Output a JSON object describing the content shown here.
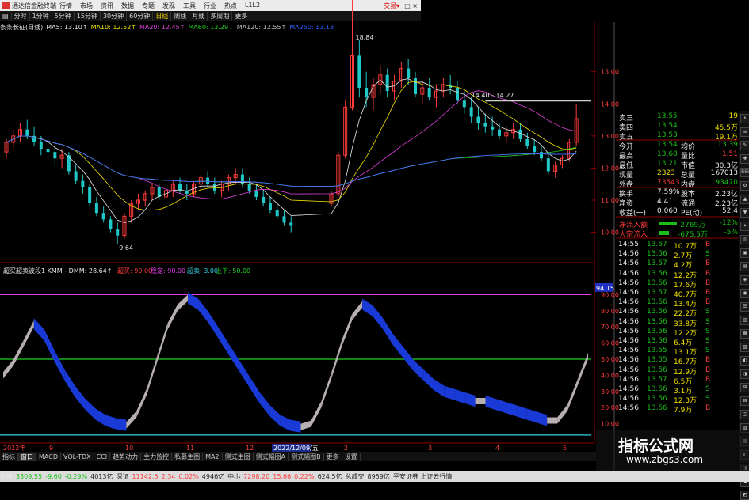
{
  "window": {
    "title": "通达信金融终端",
    "menu": [
      "行情",
      "市场",
      "资讯",
      "数据",
      "专题",
      "发现",
      "工具",
      "行业",
      "热点",
      "L1L2"
    ],
    "trade": "交易▾",
    "controls": "□ ×"
  },
  "period_tabs": [
    {
      "label": "分时"
    },
    {
      "label": "1分钟"
    },
    {
      "label": "5分钟"
    },
    {
      "label": "15分钟"
    },
    {
      "label": "30分钟"
    },
    {
      "label": "60分钟"
    },
    {
      "label": "日线",
      "active": true
    },
    {
      "label": "周线"
    },
    {
      "label": "月线"
    },
    {
      "label": "多周期"
    },
    {
      "label": "更多"
    }
  ],
  "ma_legend": {
    "name": "条条长征(日线)",
    "items": [
      {
        "text": "MA5: 13.10↑",
        "color": "#e8e8e8"
      },
      {
        "text": "MA10: 12.52↑",
        "color": "#f0e000"
      },
      {
        "text": "MA20: 12.45↑",
        "color": "#e040e0"
      },
      {
        "text": "MA60: 13.29↓",
        "color": "#20d020"
      },
      {
        "text": "MA120: 12.55↑",
        "color": "#c0c0c0"
      },
      {
        "text": "MA250: 13.13",
        "color": "#3060ff"
      }
    ]
  },
  "price_axis": {
    "labels": [
      "15.00",
      "14.00",
      "13.00",
      "12.00",
      "11.00",
      "10.00"
    ],
    "values": [
      15,
      14,
      13,
      12,
      11,
      10
    ]
  },
  "annotations": {
    "high": "18.84",
    "low": "9.64",
    "range": "14.40 - 14.27"
  },
  "indicator_legend": {
    "name": "超买超卖波段1 KMM - DMM: 28.64↑",
    "over_buy": "超买: 90.00",
    "calm": "稳定: 90.00",
    "over_sell": "超卖: 3.00",
    "up_down": "上下: 50.00"
  },
  "indicator_axis": {
    "labels": [
      "90.00",
      "80.00",
      "70.00",
      "60.00",
      "50.00",
      "40.00",
      "30.00",
      "20.00",
      "10.00"
    ],
    "values": [
      90,
      80,
      70,
      60,
      50,
      40,
      30,
      20,
      10
    ],
    "current": "94.15"
  },
  "time_axis": {
    "labels": [
      "2022年",
      "9",
      "10",
      "11",
      "12",
      "2022/12/09/五",
      "2",
      "3",
      "4",
      "5"
    ]
  },
  "chart_data": [
    {
      "type": "candlestick",
      "title": "条条长征(日线)",
      "ylim": [
        9.3,
        16.2
      ],
      "ohlc": [
        [
          12.5,
          12.9,
          12.3,
          12.8
        ],
        [
          12.8,
          13.2,
          12.6,
          13.0
        ],
        [
          13.0,
          13.4,
          12.8,
          13.2
        ],
        [
          13.2,
          13.5,
          12.9,
          13.0
        ],
        [
          13.0,
          13.3,
          12.7,
          12.8
        ],
        [
          12.8,
          13.0,
          12.4,
          12.6
        ],
        [
          12.6,
          12.9,
          12.3,
          12.5
        ],
        [
          12.5,
          12.7,
          12.1,
          12.3
        ],
        [
          12.3,
          12.6,
          12.0,
          12.4
        ],
        [
          12.4,
          12.5,
          11.8,
          11.9
        ],
        [
          11.9,
          12.1,
          11.5,
          11.6
        ],
        [
          11.6,
          11.8,
          11.2,
          11.4
        ],
        [
          11.4,
          11.5,
          10.8,
          10.9
        ],
        [
          10.9,
          11.1,
          10.5,
          10.6
        ],
        [
          10.6,
          10.8,
          10.3,
          10.4
        ],
        [
          10.4,
          10.5,
          10.0,
          10.1
        ],
        [
          10.1,
          10.3,
          9.64,
          9.9
        ],
        [
          9.9,
          10.6,
          9.8,
          10.5
        ],
        [
          10.5,
          11.0,
          10.3,
          10.9
        ],
        [
          10.9,
          11.2,
          10.7,
          11.0
        ],
        [
          11.0,
          11.3,
          10.8,
          11.2
        ],
        [
          11.2,
          11.5,
          11.0,
          11.4
        ],
        [
          11.4,
          11.5,
          11.0,
          11.1
        ],
        [
          11.1,
          11.4,
          10.9,
          11.3
        ],
        [
          11.3,
          11.6,
          11.1,
          11.5
        ],
        [
          11.5,
          11.7,
          11.2,
          11.3
        ],
        [
          11.3,
          11.5,
          11.0,
          11.2
        ],
        [
          11.2,
          11.6,
          11.1,
          11.5
        ],
        [
          11.5,
          11.8,
          11.3,
          11.7
        ],
        [
          11.7,
          11.9,
          11.4,
          11.5
        ],
        [
          11.5,
          11.7,
          11.2,
          11.3
        ],
        [
          11.3,
          11.6,
          11.1,
          11.5
        ],
        [
          11.5,
          11.8,
          11.3,
          11.7
        ],
        [
          11.7,
          12.0,
          11.5,
          11.8
        ],
        [
          11.8,
          12.0,
          11.4,
          11.5
        ],
        [
          11.5,
          11.7,
          11.2,
          11.3
        ],
        [
          11.3,
          11.5,
          11.0,
          11.1
        ],
        [
          11.1,
          11.3,
          10.8,
          10.9
        ],
        [
          10.9,
          11.1,
          10.6,
          10.7
        ],
        [
          10.7,
          10.9,
          10.4,
          10.5
        ],
        [
          10.5,
          10.7,
          10.2,
          10.3
        ],
        [
          10.3,
          10.5,
          10.0,
          10.2
        ],
        [
          10.9,
          11.3,
          10.8,
          11.2
        ],
        [
          11.2,
          12.5,
          11.1,
          12.4
        ],
        [
          12.4,
          14.1,
          12.3,
          13.9
        ],
        [
          13.9,
          18.84,
          13.8,
          15.5
        ],
        [
          15.5,
          16.0,
          14.2,
          14.5
        ],
        [
          14.5,
          15.0,
          13.9,
          14.2
        ],
        [
          14.2,
          14.8,
          13.8,
          14.6
        ],
        [
          14.6,
          15.2,
          14.3,
          14.9
        ],
        [
          14.9,
          15.1,
          14.2,
          14.4
        ],
        [
          14.4,
          14.9,
          14.1,
          14.7
        ],
        [
          14.7,
          15.3,
          14.5,
          15.1
        ],
        [
          15.1,
          15.4,
          14.6,
          14.8
        ],
        [
          14.8,
          15.0,
          14.2,
          14.3
        ],
        [
          14.3,
          14.7,
          14.0,
          14.5
        ],
        [
          14.5,
          14.8,
          14.1,
          14.2
        ],
        [
          14.2,
          14.6,
          13.9,
          14.4
        ],
        [
          14.4,
          14.8,
          14.2,
          14.6
        ],
        [
          14.6,
          14.9,
          14.3,
          14.5
        ],
        [
          14.5,
          14.7,
          14.0,
          14.1
        ],
        [
          14.1,
          14.4,
          13.7,
          13.9
        ],
        [
          13.9,
          14.2,
          13.4,
          13.6
        ],
        [
          13.6,
          13.9,
          13.2,
          13.4
        ],
        [
          13.4,
          13.7,
          13.1,
          13.3
        ],
        [
          13.3,
          13.6,
          13.0,
          13.2
        ],
        [
          13.2,
          13.4,
          12.9,
          13.0
        ],
        [
          13.0,
          13.3,
          12.8,
          13.1
        ],
        [
          13.1,
          13.4,
          12.9,
          13.2
        ],
        [
          13.2,
          13.4,
          12.8,
          12.9
        ],
        [
          12.9,
          13.1,
          12.6,
          12.7
        ],
        [
          12.7,
          12.9,
          12.4,
          12.5
        ],
        [
          12.5,
          12.7,
          12.2,
          12.3
        ],
        [
          12.3,
          12.5,
          11.8,
          11.9
        ],
        [
          11.9,
          12.2,
          11.7,
          12.1
        ],
        [
          12.1,
          12.4,
          12.0,
          12.3
        ],
        [
          12.3,
          12.9,
          12.2,
          12.8
        ],
        [
          12.8,
          14.0,
          12.7,
          13.54
        ]
      ],
      "series": [
        {
          "name": "MA5",
          "color": "#e8e8e8"
        },
        {
          "name": "MA10",
          "color": "#f0e000"
        },
        {
          "name": "MA20",
          "color": "#e040e0"
        },
        {
          "name": "MA60",
          "color": "#20d020"
        },
        {
          "name": "MA120",
          "color": "#c0c0c0"
        },
        {
          "name": "MA250",
          "color": "#3060ff"
        }
      ]
    },
    {
      "type": "area",
      "title": "超买超卖波段1",
      "ylim": [
        0,
        100
      ],
      "values": [
        40,
        48,
        60,
        72,
        65,
        52,
        40,
        30,
        22,
        16,
        12,
        10,
        9,
        16,
        30,
        50,
        70,
        82,
        88,
        84,
        76,
        66,
        56,
        46,
        36,
        26,
        18,
        12,
        9,
        8,
        10,
        22,
        40,
        60,
        76,
        84,
        80,
        72,
        62,
        54,
        46,
        40,
        34,
        30,
        28,
        26,
        24,
        24,
        22,
        20,
        18,
        16,
        14,
        12,
        12,
        20,
        36,
        52
      ],
      "lines": [
        {
          "name": "超买",
          "value": 90
        },
        {
          "name": "上下",
          "value": 50
        },
        {
          "name": "超卖",
          "value": 3
        }
      ]
    }
  ],
  "quote_panel": {
    "asks": [
      {
        "label": "卖三",
        "price": "13.55",
        "vol": "19"
      },
      {
        "label": "卖四",
        "price": "13.54",
        "vol": "45.5万"
      },
      {
        "label": "卖五",
        "price": "13.53",
        "vol": "19.1万"
      }
    ],
    "stats": [
      {
        "l1": "今开",
        "v1": "13.54",
        "c1": "dn",
        "l2": "均价",
        "v2": "13.39",
        "c2": "dn"
      },
      {
        "l1": "最高",
        "v1": "13.68",
        "c1": "dn",
        "l2": "量比",
        "v2": "1.51",
        "c2": "up"
      },
      {
        "l1": "最低",
        "v1": "13.21",
        "c1": "dn",
        "l2": "市值",
        "v2": "30.3亿",
        "c2": "wh"
      },
      {
        "l1": "现量",
        "v1": "2323",
        "c1": "yl",
        "l2": "总量",
        "v2": "167013",
        "c2": "wh"
      },
      {
        "l1": "外盘",
        "v1": "73543",
        "c1": "up",
        "l2": "内盘",
        "v2": "93470",
        "c2": "dn"
      },
      {
        "l1": "换手",
        "v1": "7.59%",
        "c1": "wh",
        "l2": "股本",
        "v2": "2.23亿",
        "c2": "wh"
      },
      {
        "l1": "净资",
        "v1": "4.41",
        "c1": "wh",
        "l2": "流通",
        "v2": "2.23亿",
        "c2": "wh"
      },
      {
        "l1": "收益(一)",
        "v1": "0.060",
        "c1": "wh",
        "l2": "PE(动)",
        "v2": "52.4",
        "c2": "wh"
      }
    ],
    "flows": [
      {
        "label": "净流入额",
        "value": "-2769万",
        "pct": "-12%"
      },
      {
        "label": "大宗流入",
        "value": "-675.5万",
        "pct": "-5%"
      }
    ],
    "ticks": [
      {
        "t": "14:55",
        "p": "13.57",
        "v": "10.7万",
        "s": "B"
      },
      {
        "t": "14:56",
        "p": "13.56",
        "v": "2.7万",
        "s": "S"
      },
      {
        "t": "14:56",
        "p": "13.57",
        "v": "4.2万",
        "s": "B"
      },
      {
        "t": "14:56",
        "p": "13.56",
        "v": "12.2万",
        "s": "B"
      },
      {
        "t": "14:56",
        "p": "13.56",
        "v": "17.6万",
        "s": "B"
      },
      {
        "t": "14:56",
        "p": "13.57",
        "v": "40.7万",
        "s": "B"
      },
      {
        "t": "14:56",
        "p": "13.56",
        "v": "13.4万",
        "s": "B"
      },
      {
        "t": "14:56",
        "p": "13.56",
        "v": "22.2万",
        "s": "S"
      },
      {
        "t": "14:56",
        "p": "13.56",
        "v": "33.8万",
        "s": "S"
      },
      {
        "t": "14:56",
        "p": "13.56",
        "v": "12.2万",
        "s": "S"
      },
      {
        "t": "14:56",
        "p": "13.56",
        "v": "6.4万",
        "s": "S"
      },
      {
        "t": "14:56",
        "p": "13.55",
        "v": "13.1万",
        "s": "S"
      },
      {
        "t": "14:56",
        "p": "13.55",
        "v": "16.7万",
        "s": "B"
      },
      {
        "t": "14:56",
        "p": "13.56",
        "v": "12.9万",
        "s": "B"
      },
      {
        "t": "14:56",
        "p": "13.57",
        "v": "6.5万",
        "s": "B"
      },
      {
        "t": "14:56",
        "p": "13.56",
        "v": "3.1万",
        "s": "S"
      },
      {
        "t": "14:56",
        "p": "13.56",
        "v": "12.3万",
        "s": "S"
      },
      {
        "t": "14:56",
        "p": "13.56",
        "v": "7.9万",
        "s": "B"
      }
    ]
  },
  "bottom_tabs": [
    "指标",
    "窗口",
    "MACD",
    "VOL-TDX",
    "CCI",
    "趋势动力",
    "主力监控",
    "私募主图",
    "MA2",
    "侧式主图",
    "侧式幅图A",
    "侧式幅图B",
    "更多",
    "设置"
  ],
  "status_bar": {
    "sh": {
      "label": "上证",
      "value": "3309.55",
      "chg": "-9.60",
      "pct": "-0.29%",
      "amt": "4013亿"
    },
    "sz": {
      "label": "深证",
      "value": "11142.5",
      "chg": "2.34",
      "pct": "0.02%",
      "amt": "4946亿"
    },
    "zx": {
      "label": "中小",
      "value": "7298.20",
      "chg": "15.66",
      "pct": "0.22%",
      "amt": "624.5亿"
    },
    "total": {
      "label": "总成交",
      "value": "8959亿"
    },
    "ticker": "平安证券 上证云行情"
  },
  "right_toolbar": {
    "items": [
      "ℹ",
      "≡",
      "✎",
      "✚",
      "RSI",
      "⚙",
      "▲",
      "▼",
      "✦",
      "◎",
      "▣",
      "▤",
      "◈",
      "◉",
      "☰",
      "▥",
      "▦",
      "▧",
      "◐",
      "◑",
      "⊞",
      "⊟",
      "◫",
      "▨",
      "▩",
      "◧",
      "◨",
      "◪",
      "◩"
    ]
  },
  "watermark": {
    "cn": "指标公式网",
    "en": "www.zbgs3.com"
  },
  "colors": {
    "up": "#ff3b3b",
    "down": "#18c018",
    "grid": "#8b0000",
    "band_blue": "#1a3ad8",
    "band_gray": "#b8b0b0"
  }
}
